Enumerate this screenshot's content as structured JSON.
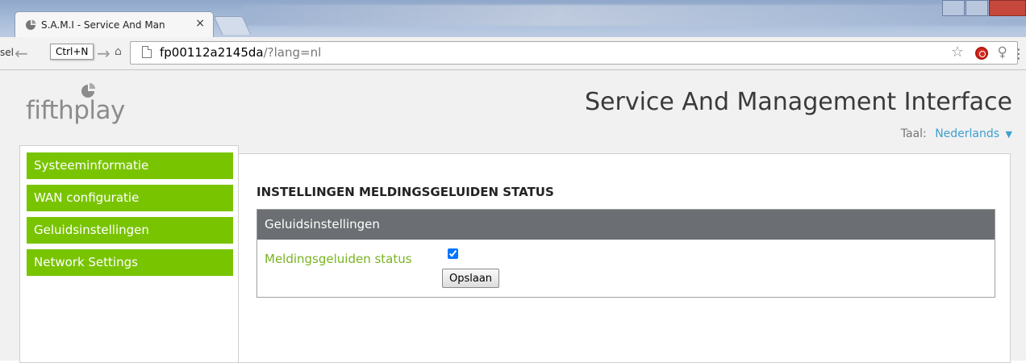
{
  "browser": {
    "tab_title": "S.A.M.I - Service And Man",
    "tab_close": "×",
    "back_fragment": "sel",
    "tooltip": "Ctrl+N",
    "url_host": "fp00112a2145da",
    "url_path": "/?lang=nl"
  },
  "header": {
    "logo_text": "fifthplay",
    "app_title": "Service And Management Interface",
    "language_label": "Taal:",
    "language_value": "Nederlands",
    "language_caret": "▼"
  },
  "sidebar": {
    "items": [
      {
        "label": "Systeeminformatie"
      },
      {
        "label": "WAN configuratie"
      },
      {
        "label": "Geluidsinstellingen"
      },
      {
        "label": "Network Settings"
      }
    ]
  },
  "main": {
    "heading": "INSTELLINGEN MELDINGSGELUIDEN STATUS",
    "box_title": "Geluidsinstellingen",
    "setting_label": "Meldingsgeluiden status",
    "setting_checked": true,
    "save_label": "Opslaan"
  },
  "colors": {
    "nav_green": "#79c400",
    "label_green": "#79b321",
    "header_grey": "#6b6e72",
    "link_blue": "#3f9fd0"
  }
}
